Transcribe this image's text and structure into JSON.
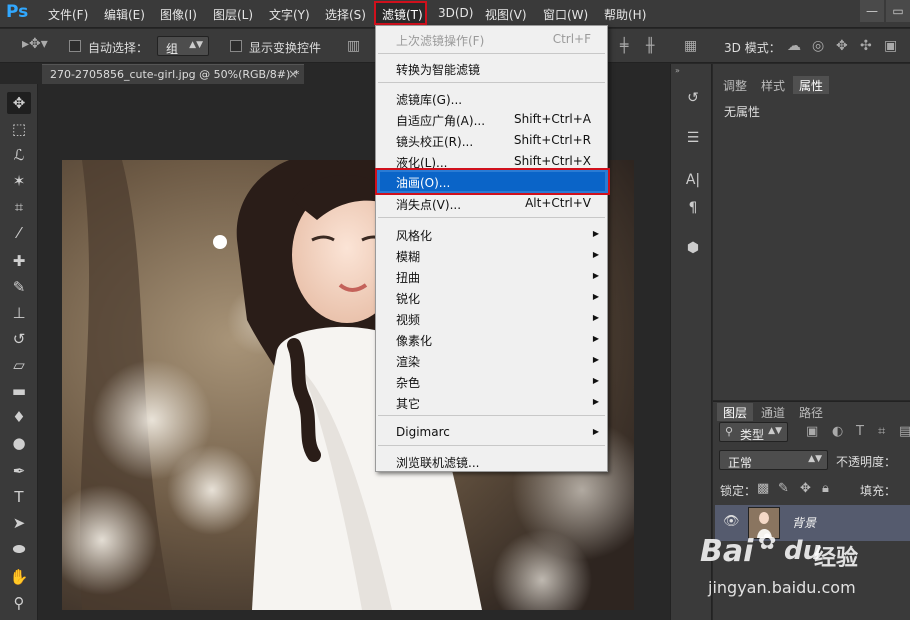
{
  "app": {
    "logo": "Ps"
  },
  "menubar": {
    "items": [
      "文件(F)",
      "编辑(E)",
      "图像(I)",
      "图层(L)",
      "文字(Y)",
      "选择(S)",
      "滤镜(T)",
      "3D(D)",
      "视图(V)",
      "窗口(W)",
      "帮助(H)"
    ],
    "active": "滤镜(T)"
  },
  "options_bar": {
    "auto_select_label": "自动选择：",
    "auto_select_value": "组",
    "show_transform_label": "显示变换控件",
    "mode_3d_label": "3D 模式："
  },
  "document": {
    "tab_title": "270-2705856_cute-girl.jpg @ 50%(RGB/8#) *",
    "close": "×"
  },
  "filter_menu": {
    "last_filter": {
      "label": "上次滤镜操作(F)",
      "shortcut": "Ctrl+F"
    },
    "smart_filters": "转换为智能滤镜",
    "group1": [
      {
        "label": "滤镜库(G)...",
        "shortcut": ""
      },
      {
        "label": "自适应广角(A)...",
        "shortcut": "Shift+Ctrl+A"
      },
      {
        "label": "镜头校正(R)...",
        "shortcut": "Shift+Ctrl+R"
      },
      {
        "label": "液化(L)...",
        "shortcut": "Shift+Ctrl+X"
      },
      {
        "label": "油画(O)...",
        "shortcut": ""
      },
      {
        "label": "消失点(V)...",
        "shortcut": "Alt+Ctrl+V"
      }
    ],
    "group2": [
      "风格化",
      "模糊",
      "扭曲",
      "锐化",
      "视频",
      "像素化",
      "渲染",
      "杂色",
      "其它"
    ],
    "digimarc": "Digimarc",
    "browse_online": "浏览联机滤镜..."
  },
  "props_panel": {
    "tabs": [
      "调整",
      "样式",
      "属性"
    ],
    "active_tab": "属性",
    "empty_text": "无属性"
  },
  "layers_panel": {
    "tabs": [
      "图层",
      "通道",
      "路径"
    ],
    "kind_label": "类型",
    "blend_mode": "正常",
    "opacity_label": "不透明度：",
    "lock_label": "锁定：",
    "fill_label": "填充：",
    "layer_name": "背景"
  },
  "watermark": {
    "brand1": "Bai",
    "brand2": "du",
    "cn": "经验",
    "url": "jingyan.baidu.com"
  },
  "colors": {
    "menu_bg": "#3a3a3a",
    "panel_bg": "#3a3a3a",
    "highlight_red": "#d0101c",
    "menu_selected": "#0a64c8",
    "dropdown_bg": "#f0f0f0"
  }
}
